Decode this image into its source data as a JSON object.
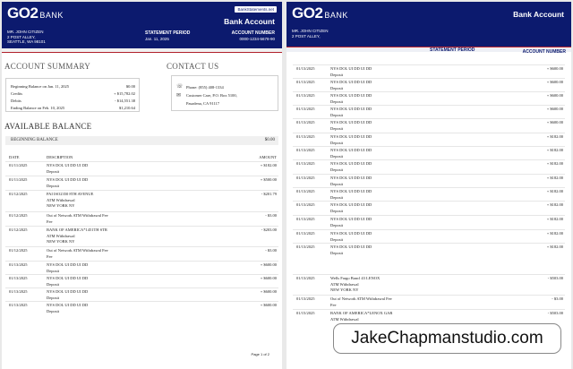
{
  "bank": {
    "logo": "GO2",
    "logo_sub": "BANK",
    "account_title": "Bank Account",
    "badge": "BankStatements.net"
  },
  "customer": {
    "name": "MR. JOHN CITIZEN",
    "street": "2 POST ALLEY,",
    "city": "SEATTLE, WA 98101"
  },
  "statement": {
    "period_label": "STATEMENT PERIOD",
    "period_value": "Jan. 11, 2025",
    "account_label": "ACCOUNT NUMBER",
    "account_value": "0000-1234-5678-90"
  },
  "summary": {
    "title": "ACCOUNT SUMMARY",
    "rows": [
      {
        "label": "Beginning Balance on Jan. 11, 2025",
        "value": "$0.00"
      },
      {
        "label": "Credits",
        "value": "+ $15,782.02"
      },
      {
        "label": "Debits",
        "value": "- $14,551.38"
      },
      {
        "label": "Ending Balance on Feb. 10, 2025",
        "value": "$1,210.64"
      }
    ]
  },
  "contact": {
    "title": "CONTACT US",
    "phone": "Phone: (855) 408-1334",
    "care": "Customer Care, P.O. Box 5100,",
    "city": "Pasadena, CA 91117"
  },
  "available": {
    "title": "AVAILABLE BALANCE",
    "beginning_label": "BEGINNING BALANCE",
    "beginning_value": "$0.00",
    "col_date": "DATE",
    "col_desc": "DESCRIPTION",
    "col_amount": "AMOUNT"
  },
  "page1_tx": [
    {
      "date": "01/11/2025",
      "lines": [
        "NYS DOL UI DD UI DD",
        "Deposit"
      ],
      "amount": "+ $182.00"
    },
    {
      "date": "01/11/2025",
      "lines": [
        "NYS DOL UI DD UI DD",
        "Deposit"
      ],
      "amount": "+ $500.00"
    },
    {
      "date": "01/12/2025",
      "lines": [
        "PAI ISO2350 8TH AVENUE",
        "ATM Withdrawal",
        "NEW YORK NY"
      ],
      "amount": "- $201.79"
    },
    {
      "date": "01/12/2025",
      "lines": [
        "Out of Network ATM Withdrawal Fee",
        "Fee"
      ],
      "amount": "- $3.00"
    },
    {
      "date": "01/12/2025",
      "lines": [
        "BANK OF AMERICA*1451TH STR",
        "ATM Withdrawal",
        "NEW YORK NY"
      ],
      "amount": "- $203.00"
    },
    {
      "date": "01/12/2025",
      "lines": [
        "Out of Network ATM Withdrawal Fee",
        "Fee"
      ],
      "amount": "- $3.00"
    },
    {
      "date": "01/13/2025",
      "lines": [
        "NYS DOL UI DD UI DD",
        "Deposit"
      ],
      "amount": "+ $600.00"
    },
    {
      "date": "01/13/2025",
      "lines": [
        "NYS DOL UI DD UI DD",
        "Deposit"
      ],
      "amount": "+ $600.00"
    },
    {
      "date": "01/13/2025",
      "lines": [
        "NYS DOL UI DD UI DD",
        "Deposit"
      ],
      "amount": "+ $600.00"
    },
    {
      "date": "01/13/2025",
      "lines": [
        "NYS DOL UI DD UI DD",
        "Deposit"
      ],
      "amount": "+ $600.00"
    }
  ],
  "page1_no": "Page 1 of 2",
  "page2_tx": [
    {
      "date": "01/13/2025",
      "lines": [
        "NYS DOL UI DD UI DD",
        "Deposit"
      ],
      "amount": "+ $600.00"
    },
    {
      "date": "01/13/2025",
      "lines": [
        "NYS DOL UI DD UI DD",
        "Deposit"
      ],
      "amount": "+ $600.00"
    },
    {
      "date": "01/13/2025",
      "lines": [
        "NYS DOL UI DD UI DD",
        "Deposit"
      ],
      "amount": "+ $600.00"
    },
    {
      "date": "01/13/2025",
      "lines": [
        "NYS DOL UI DD UI DD",
        "Deposit"
      ],
      "amount": "+ $600.00"
    },
    {
      "date": "01/13/2025",
      "lines": [
        "NYS DOL UI DD UI DD",
        "Deposit"
      ],
      "amount": "+ $600.00"
    },
    {
      "date": "01/13/2025",
      "lines": [
        "NYS DOL UI DD UI DD",
        "Deposit"
      ],
      "amount": "+ $182.00"
    },
    {
      "date": "01/13/2025",
      "lines": [
        "NYS DOL UI DD UI DD",
        "Deposit"
      ],
      "amount": "+ $182.00"
    },
    {
      "date": "01/13/2025",
      "lines": [
        "NYS DOL UI DD UI DD",
        "Deposit"
      ],
      "amount": "+ $182.00"
    },
    {
      "date": "01/13/2025",
      "lines": [
        "NYS DOL UI DD UI DD",
        "Deposit"
      ],
      "amount": "+ $182.00"
    },
    {
      "date": "01/13/2025",
      "lines": [
        "NYS DOL UI DD UI DD",
        "Deposit"
      ],
      "amount": "+ $182.00"
    },
    {
      "date": "01/13/2025",
      "lines": [
        "NYS DOL UI DD UI DD",
        "Deposit"
      ],
      "amount": "+ $182.00"
    },
    {
      "date": "01/13/2025",
      "lines": [
        "NYS DOL UI DD UI DD",
        "Deposit"
      ],
      "amount": "+ $182.00"
    },
    {
      "date": "01/13/2025",
      "lines": [
        "NYS DOL UI DD UI DD",
        "Deposit"
      ],
      "amount": "+ $182.00"
    },
    {
      "date": "01/13/2025",
      "lines": [
        "NYS DOL UI DD UI DD",
        "Deposit"
      ],
      "amount": "+ $182.00"
    },
    {
      "date": "01/13/2025",
      "lines": [
        "Wells Fargo Bancl 43 LENOX",
        "ATM Withdrawal",
        "NEW YORK NY"
      ],
      "amount": "- $503.00"
    },
    {
      "date": "01/13/2025",
      "lines": [
        "Out of Network ATM Withdrawal Fee",
        "Fee"
      ],
      "amount": "- $3.00"
    },
    {
      "date": "01/15/2025",
      "lines": [
        "BANK OF AMERICA*LENOX GAR",
        "ATM Withdrawal"
      ],
      "amount": "- $503.00"
    }
  ],
  "watermark": "JakeChapmanstudio.com"
}
